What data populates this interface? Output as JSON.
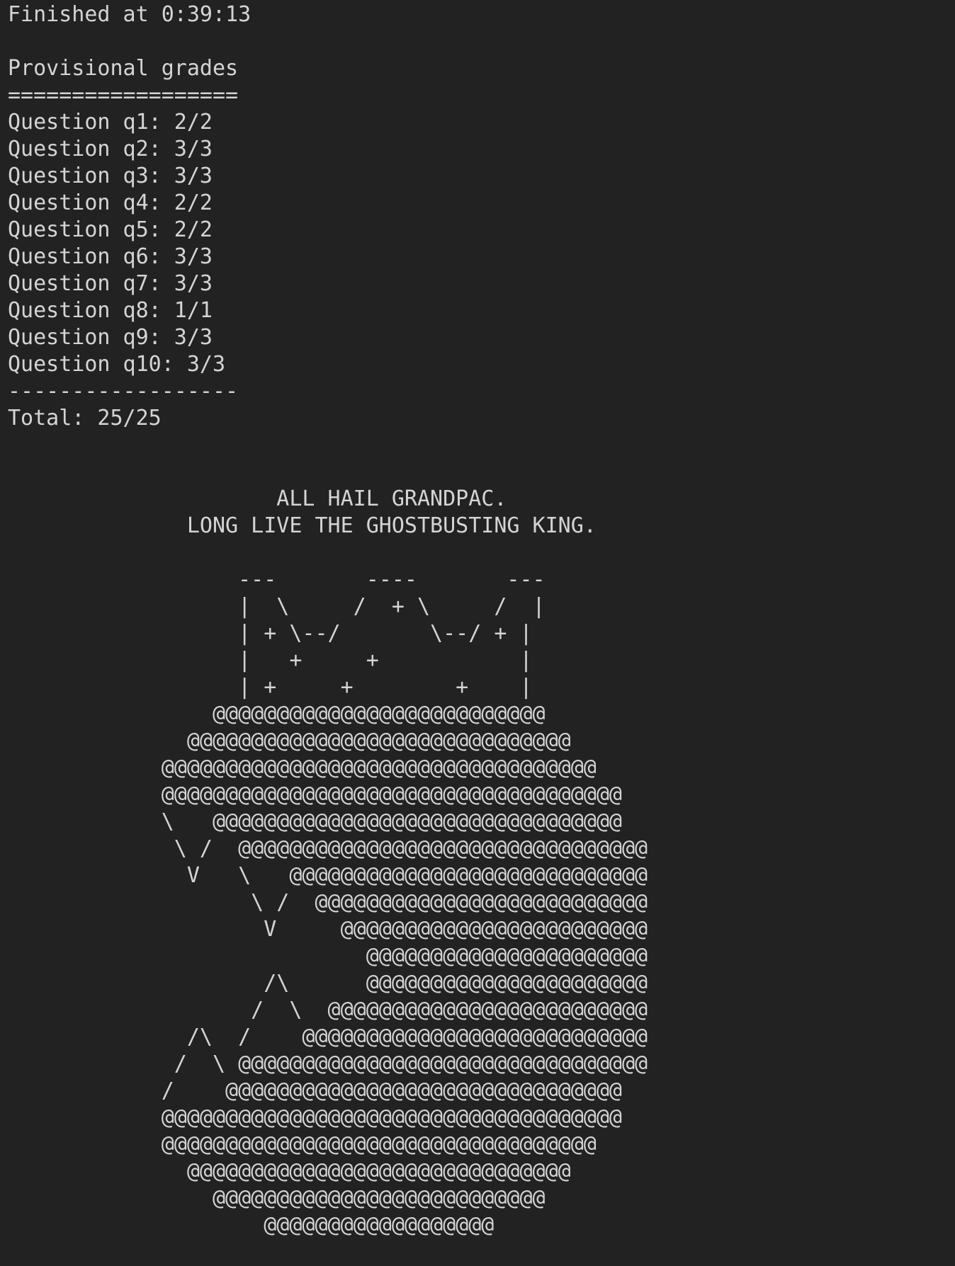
{
  "terminal": {
    "lines": [
      "Finished at 0:39:13",
      "",
      "Provisional grades",
      "==================",
      "Question q1: 2/2",
      "Question q2: 3/3",
      "Question q3: 3/3",
      "Question q4: 2/2",
      "Question q5: 2/2",
      "Question q6: 3/3",
      "Question q7: 3/3",
      "Question q8: 1/1",
      "Question q9: 3/3",
      "Question q10: 3/3",
      "------------------",
      "Total: 25/25",
      "",
      "",
      "                     ALL HAIL GRANDPAC.",
      "              LONG LIVE THE GHOSTBUSTING KING.",
      "",
      "                  ---       ----       ---",
      "                  |  \\     /  + \\     /  |",
      "                  | + \\--/       \\--/ + |",
      "                  |   +     +           |",
      "                  | +     +        +    |",
      "                @@@@@@@@@@@@@@@@@@@@@@@@@@",
      "              @@@@@@@@@@@@@@@@@@@@@@@@@@@@@@",
      "            @@@@@@@@@@@@@@@@@@@@@@@@@@@@@@@@@@",
      "            @@@@@@@@@@@@@@@@@@@@@@@@@@@@@@@@@@@@",
      "            \\   @@@@@@@@@@@@@@@@@@@@@@@@@@@@@@@@",
      "             \\ /  @@@@@@@@@@@@@@@@@@@@@@@@@@@@@@@@",
      "              V   \\   @@@@@@@@@@@@@@@@@@@@@@@@@@@@",
      "                   \\ /  @@@@@@@@@@@@@@@@@@@@@@@@@@",
      "                    V     @@@@@@@@@@@@@@@@@@@@@@@@",
      "                            @@@@@@@@@@@@@@@@@@@@@@",
      "                    /\\      @@@@@@@@@@@@@@@@@@@@@@",
      "                   /  \\  @@@@@@@@@@@@@@@@@@@@@@@@@",
      "              /\\  /    @@@@@@@@@@@@@@@@@@@@@@@@@@@",
      "             /  \\ @@@@@@@@@@@@@@@@@@@@@@@@@@@@@@@@",
      "            /    @@@@@@@@@@@@@@@@@@@@@@@@@@@@@@@",
      "            @@@@@@@@@@@@@@@@@@@@@@@@@@@@@@@@@@@@",
      "            @@@@@@@@@@@@@@@@@@@@@@@@@@@@@@@@@@",
      "              @@@@@@@@@@@@@@@@@@@@@@@@@@@@@@",
      "                @@@@@@@@@@@@@@@@@@@@@@@@@@",
      "                    @@@@@@@@@@@@@@@@@@"
    ]
  }
}
